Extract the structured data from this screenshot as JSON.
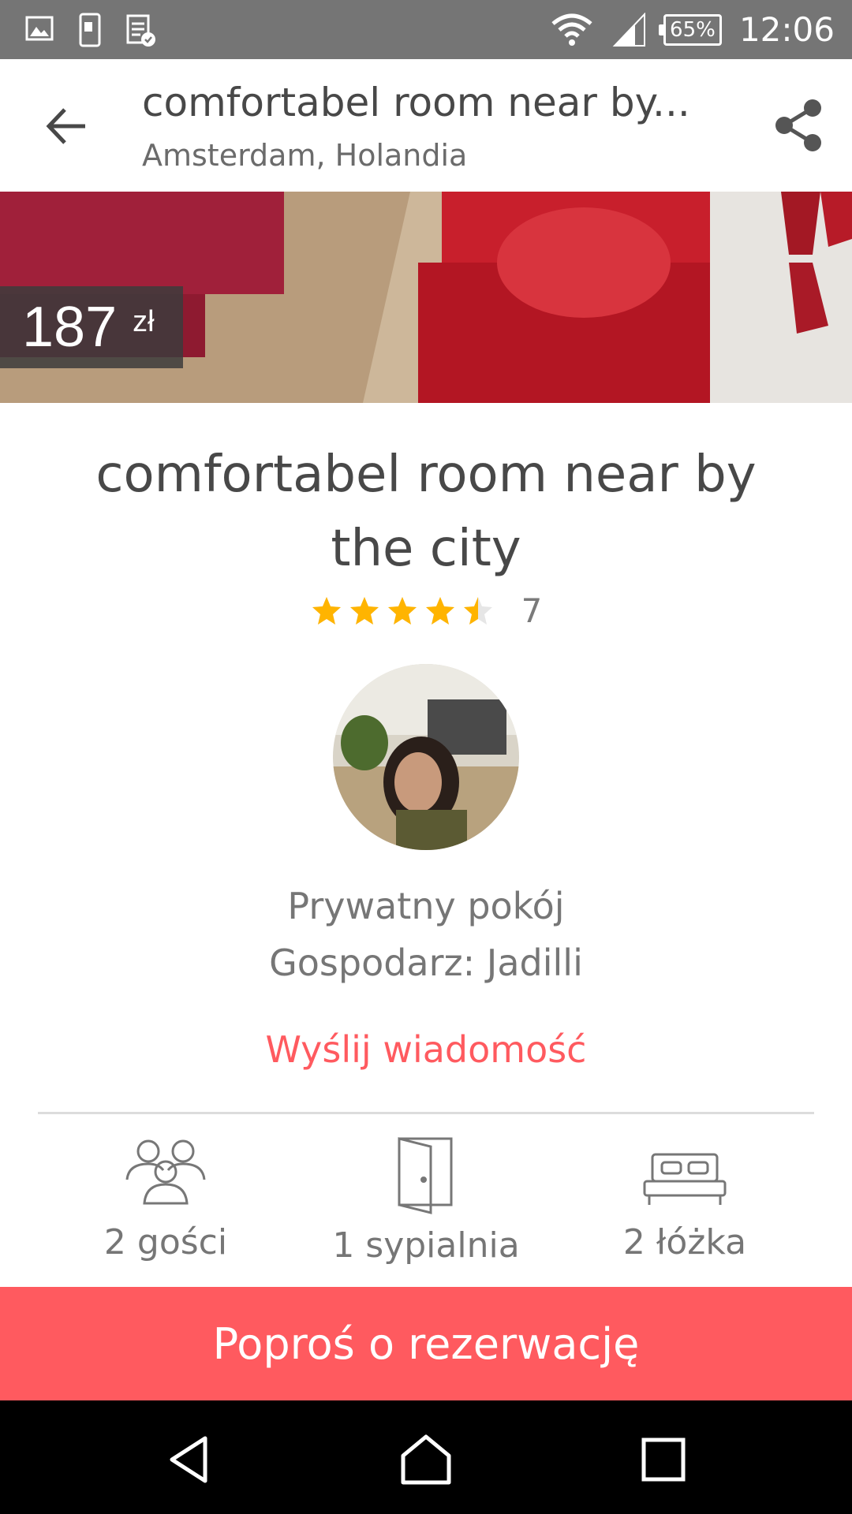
{
  "status_bar": {
    "time": "12:06",
    "battery": "65%"
  },
  "app_bar": {
    "title": "comfortabel room near by...",
    "subtitle": "Amsterdam, Holandia"
  },
  "hero": {
    "price": "187",
    "currency": "zł"
  },
  "listing": {
    "title": "comfortabel room near by the city",
    "rating": 4.5,
    "review_count": "7",
    "room_type": "Prywatny pokój",
    "host": "Gospodarz: Jadilli",
    "message_link": "Wyślij wiadomość"
  },
  "amenities": [
    {
      "label": "2 gości",
      "icon": "guests-icon"
    },
    {
      "label": "1 sypialnia",
      "icon": "door-icon"
    },
    {
      "label": "2 łóżka",
      "icon": "bed-icon"
    }
  ],
  "book_button": "Poproś o rezerwację",
  "colors": {
    "accent": "#ff5a5f",
    "star": "#ffb400"
  }
}
